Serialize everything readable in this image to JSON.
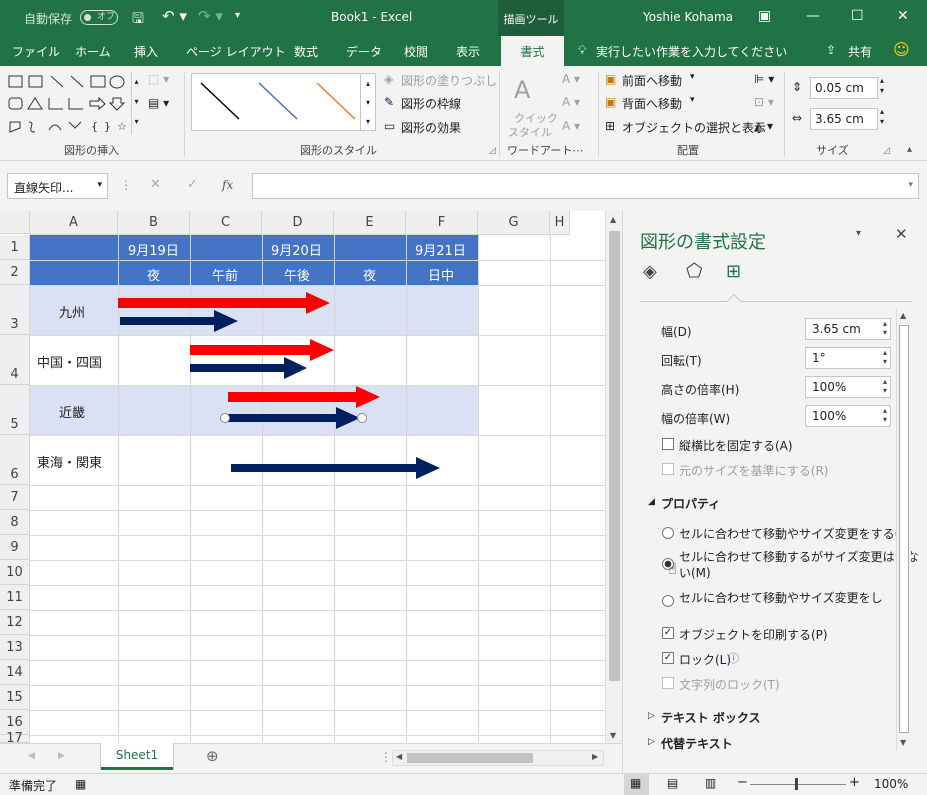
{
  "titlebar": {
    "autosave": "自動保存",
    "autosave_state": "オフ",
    "title": "Book1  -  Excel",
    "context_tool": "描画ツール",
    "user": "Yoshie Kohama"
  },
  "tabs": [
    "ファイル",
    "ホーム",
    "挿入",
    "ページ レイアウト",
    "数式",
    "データ",
    "校閲",
    "表示"
  ],
  "active_tab": "書式",
  "tellme": "実行したい作業を入力してください",
  "share": "共有",
  "ribbon": {
    "groups": {
      "insert": "図形の挿入",
      "style": "図形のスタイル",
      "wordart": "ワードアート⋯",
      "arrange": "配置",
      "size": "サイズ"
    },
    "fill": "図形の塗りつぶし",
    "outline": "図形の枠線",
    "effects": "図形の効果",
    "quick_style": [
      "クイック",
      "スタイル"
    ],
    "front": "前面へ移動",
    "back": "背面へ移動",
    "selection": "オブジェクトの選択と表示",
    "height": "0.05 cm",
    "width": "3.65 cm"
  },
  "namebox": "直線矢印...",
  "fx": "fx",
  "columns": [
    "A",
    "B",
    "C",
    "D",
    "E",
    "F",
    "G",
    "H"
  ],
  "rows": [
    "1",
    "2",
    "3",
    "4",
    "5",
    "6",
    "7",
    "8",
    "9",
    "10",
    "11",
    "12",
    "13",
    "14",
    "15",
    "16",
    "17"
  ],
  "header_cells": {
    "d1": "9月19日",
    "d2": "9月20日",
    "d3": "9月21日",
    "t1": "夜",
    "t2": "午前",
    "t3": "午後",
    "t4": "夜",
    "t5": "日中"
  },
  "regions": [
    "九州",
    "中国・四国",
    "近畿",
    "東海・関東"
  ],
  "pane": {
    "title": "図形の書式設定",
    "width_label": "幅(D)",
    "width_val": "3.65 cm",
    "rotate_label": "回転(T)",
    "rotate_val": "1°",
    "hscale_label": "高さの倍率(H)",
    "hscale_val": "100%",
    "wscale_label": "幅の倍率(W)",
    "wscale_val": "100%",
    "lock_ratio": "縦横比を固定する(A)",
    "orig_size": "元のサイズを基準にする(R)",
    "properties": "プロパティ",
    "r1": "セルに合わせて移動やサイズ変更をする(S)",
    "r2a": "セルに合わせて移動するがサイズ変更はしな",
    "r2b": "い(M)",
    "r3": "セルに合わせて移動やサイズ変更をしない(D)",
    "print": "オブジェクトを印刷する(P)",
    "lock": "ロック(L)",
    "lock_text": "文字列のロック(T)",
    "textbox": "テキスト ボックス",
    "alt_text": "代替テキスト"
  },
  "sheet": "Sheet1",
  "status": "準備完了",
  "zoom": "100%",
  "colors": {
    "accent": "#217346",
    "header_fill": "#4472c4",
    "band_fill": "#d9e1f2",
    "red_arrow": "#ff0000",
    "navy_arrow": "#002060"
  }
}
